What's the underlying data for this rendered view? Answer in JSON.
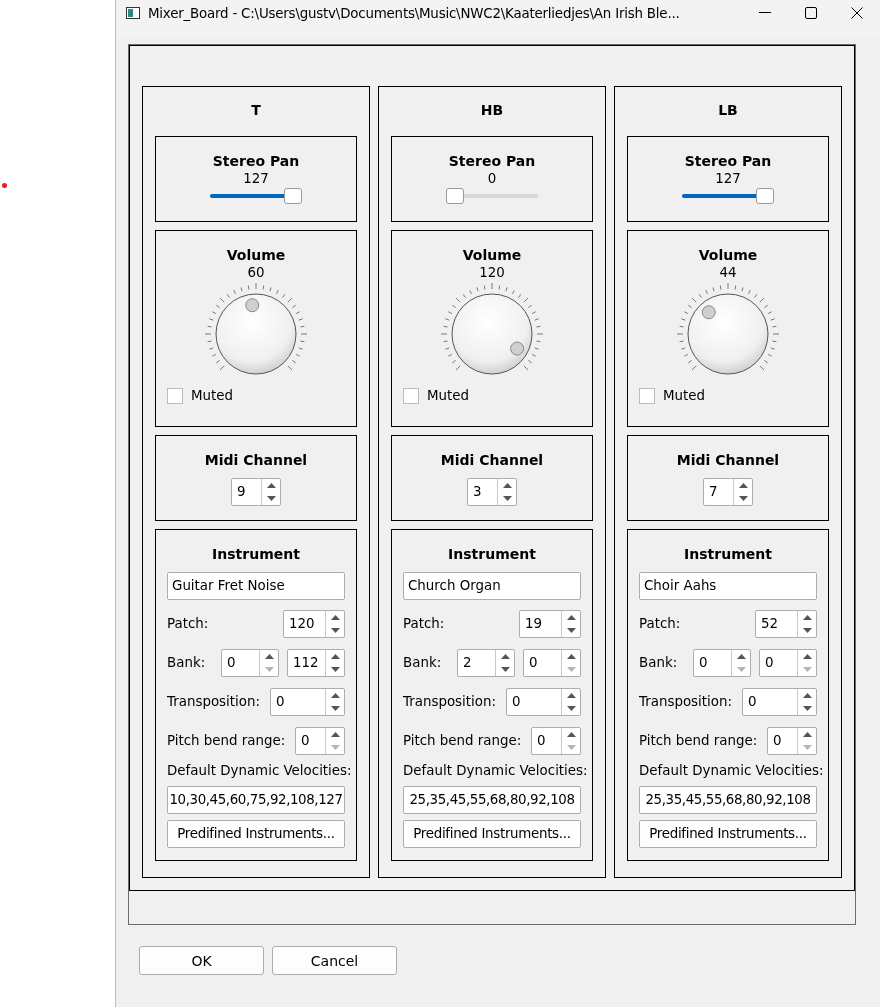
{
  "window": {
    "title": "Mixer_Board - C:\\Users\\gustv\\Documents\\Music\\NWC2\\Kaaterliedjes\\An Irish Ble..."
  },
  "channels": [
    {
      "name": "T",
      "pan": {
        "label": "Stereo Pan",
        "value": "127",
        "level": 1
      },
      "volume": {
        "label": "Volume",
        "value": "60"
      },
      "muted": {
        "label": "Muted",
        "checked": false
      },
      "midi": {
        "label": "Midi Channel",
        "value": "9",
        "down_disabled": false
      },
      "instrument": {
        "label": "Instrument",
        "name": "Guitar Fret Noise",
        "patch_label": "Patch:",
        "patch": {
          "value": "120",
          "down_disabled": false
        },
        "bank_label": "Bank:",
        "bank": [
          {
            "value": "0",
            "down_disabled": true
          },
          {
            "value": "112",
            "down_disabled": false
          }
        ],
        "transposition_label": "Transposition:",
        "transposition": {
          "value": "0",
          "down_disabled": false
        },
        "pitch_bend_label": "Pitch bend range:",
        "pitch_bend": {
          "value": "0",
          "down_disabled": true
        },
        "velocities_label": "Default Dynamic Velocities:",
        "velocities": "10,30,45,60,75,92,108,127",
        "predefined_button": "Predifined Instruments..."
      }
    },
    {
      "name": "HB",
      "pan": {
        "label": "Stereo Pan",
        "value": "0",
        "level": 0
      },
      "volume": {
        "label": "Volume",
        "value": "120"
      },
      "muted": {
        "label": "Muted",
        "checked": false
      },
      "midi": {
        "label": "Midi Channel",
        "value": "3",
        "down_disabled": false
      },
      "instrument": {
        "label": "Instrument",
        "name": "Church Organ",
        "patch_label": "Patch:",
        "patch": {
          "value": "19",
          "down_disabled": false
        },
        "bank_label": "Bank:",
        "bank": [
          {
            "value": "2",
            "down_disabled": false
          },
          {
            "value": "0",
            "down_disabled": true
          }
        ],
        "transposition_label": "Transposition:",
        "transposition": {
          "value": "0",
          "down_disabled": false
        },
        "pitch_bend_label": "Pitch bend range:",
        "pitch_bend": {
          "value": "0",
          "down_disabled": true
        },
        "velocities_label": "Default Dynamic Velocities:",
        "velocities": "25,35,45,55,68,80,92,108",
        "predefined_button": "Predifined Instruments..."
      }
    },
    {
      "name": "LB",
      "pan": {
        "label": "Stereo Pan",
        "value": "127",
        "level": 1
      },
      "volume": {
        "label": "Volume",
        "value": "44"
      },
      "muted": {
        "label": "Muted",
        "checked": false
      },
      "midi": {
        "label": "Midi Channel",
        "value": "7",
        "down_disabled": false
      },
      "instrument": {
        "label": "Instrument",
        "name": "Choir Aahs",
        "patch_label": "Patch:",
        "patch": {
          "value": "52",
          "down_disabled": false
        },
        "bank_label": "Bank:",
        "bank": [
          {
            "value": "0",
            "down_disabled": true
          },
          {
            "value": "0",
            "down_disabled": true
          }
        ],
        "transposition_label": "Transposition:",
        "transposition": {
          "value": "0",
          "down_disabled": false
        },
        "pitch_bend_label": "Pitch bend range:",
        "pitch_bend": {
          "value": "0",
          "down_disabled": true
        },
        "velocities_label": "Default Dynamic Velocities:",
        "velocities": "25,35,45,55,68,80,92,108",
        "predefined_button": "Predifined Instruments..."
      }
    }
  ],
  "buttons": [
    {
      "label": "OK"
    },
    {
      "label": "Cancel"
    }
  ]
}
